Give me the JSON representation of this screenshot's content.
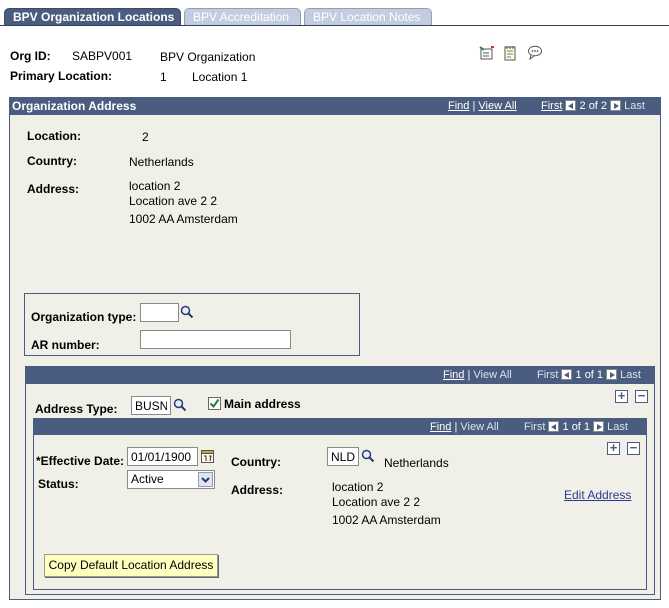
{
  "tabs": [
    "BPV Organization Locations",
    "BPV Accreditation",
    "BPV Location Notes"
  ],
  "header": {
    "org_id_label": "Org ID:",
    "org_id_value": "SABPV001",
    "org_name": "BPV Organization",
    "primary_location_label": "Primary Location:",
    "primary_location_num": "1",
    "primary_location_name": "Location 1"
  },
  "address_panel": {
    "title": "Organization Address",
    "find": "Find",
    "sep": "|",
    "view_all": "View All",
    "first": "First",
    "count": "2 of 2",
    "last": "Last",
    "location_label": "Location:",
    "location_value": "2",
    "country_label": "Country:",
    "country_value": "Netherlands",
    "address_label": "Address:",
    "address_line1": "location 2",
    "address_line2": "Location ave 2 2",
    "address_line3": "1002 AA Amsterdam"
  },
  "org_box": {
    "org_type_label": "Organization type:",
    "org_type_value": "",
    "ar_number_label": "AR number:",
    "ar_number_value": ""
  },
  "address_type_section": {
    "find": "Find",
    "sep": "|",
    "view_all": "View All",
    "first": "First",
    "count": "1 of 1",
    "last": "Last",
    "address_type_label": "Address Type:",
    "address_type_value": "BUSN",
    "main_address_label": "Main address",
    "main_address_checked": true
  },
  "effdt_section": {
    "find": "Find",
    "sep": "|",
    "view_all": "View All",
    "first": "First",
    "count": "1 of 1",
    "last": "Last",
    "effective_date_label": "*Effective Date:",
    "effective_date_value": "01/01/1900",
    "status_label": "Status:",
    "status_value": "Active",
    "country_label": "Country:",
    "country_code": "NLD",
    "country_name": "Netherlands",
    "address_label": "Address:",
    "address_line1": "location 2",
    "address_line2": "Location ave 2 2",
    "address_line3": "1002 AA Amsterdam",
    "edit_address": "Edit Address",
    "copy_button": "Copy Default Location Address"
  },
  "colors": {
    "bar": "#4a5d80",
    "panel": "#f0f0e8",
    "button": "#ffffc0"
  }
}
